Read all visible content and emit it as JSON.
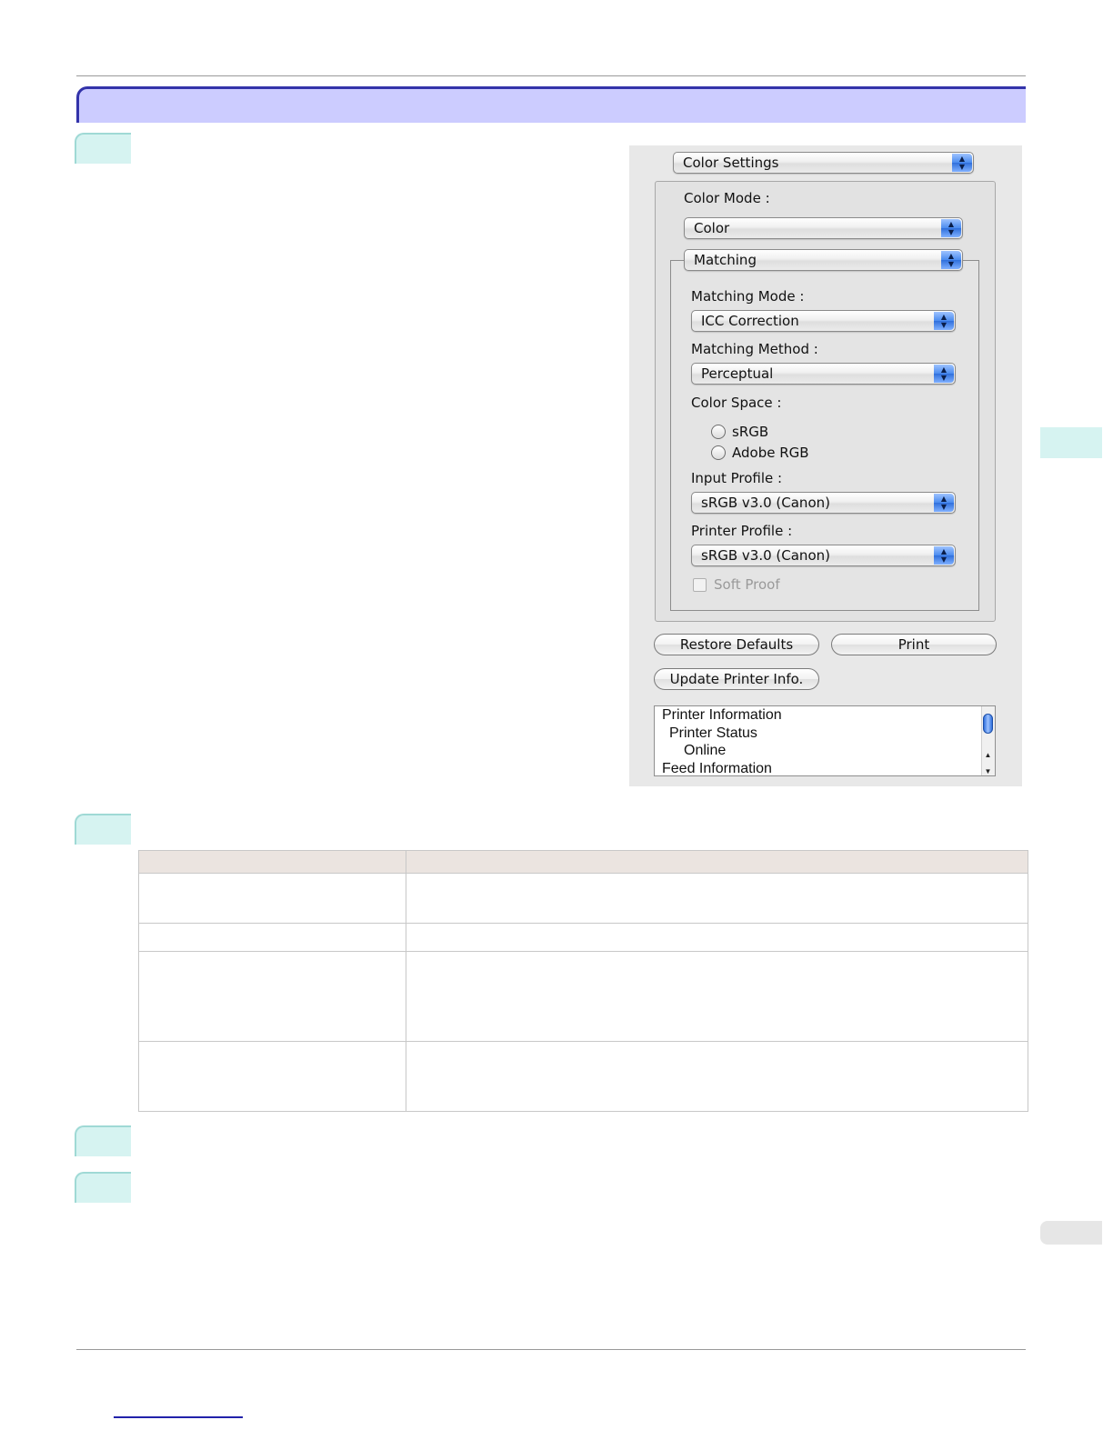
{
  "dialog": {
    "panel_popup": "Color Settings",
    "color_mode_label": "Color Mode :",
    "color_mode_value": "Color",
    "section_popup": "Matching",
    "matching_mode_label": "Matching Mode :",
    "matching_mode_value": "ICC Correction",
    "matching_method_label": "Matching Method :",
    "matching_method_value": "Perceptual",
    "color_space_label": "Color Space :",
    "color_space_options": [
      "sRGB",
      "Adobe RGB"
    ],
    "input_profile_label": "Input Profile :",
    "input_profile_value": "sRGB v3.0 (Canon)",
    "printer_profile_label": "Printer Profile :",
    "printer_profile_value": "sRGB v3.0 (Canon)",
    "soft_proof_label": "Soft Proof",
    "restore_defaults_label": "Restore Defaults",
    "print_label": "Print",
    "update_printer_info_label": "Update Printer Info.",
    "info_list": [
      "Printer Information",
      "Printer Status",
      "Online",
      "Feed Information"
    ]
  },
  "colors": {
    "banner_fill": "#ccccff",
    "banner_border": "#3333aa",
    "step_tab": "#d6f3f1",
    "table_header": "#ebe4e0",
    "popup_arrow_blue": "#4a8bef"
  },
  "icons": {
    "popup_arrows": "up-down-chevron-icon",
    "scroll_up": "scroll-up-arrow-icon",
    "scroll_down": "scroll-down-arrow-icon"
  }
}
